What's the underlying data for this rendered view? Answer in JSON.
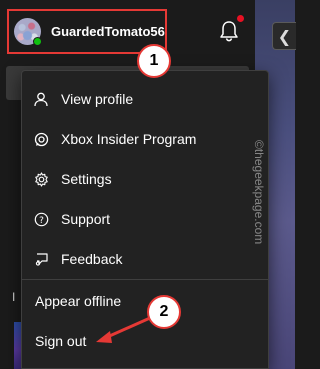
{
  "header": {
    "gamertag": "GuardedTomato56",
    "presence": "online"
  },
  "menu": {
    "items": [
      {
        "label": "View profile",
        "icon": "person-icon"
      },
      {
        "label": "Xbox Insider Program",
        "icon": "xbox-insider-icon"
      },
      {
        "label": "Settings",
        "icon": "gear-icon"
      },
      {
        "label": "Support",
        "icon": "help-icon"
      },
      {
        "label": "Feedback",
        "icon": "feedback-icon"
      }
    ],
    "appear_offline": "Appear offline",
    "sign_out": "Sign out"
  },
  "annotations": {
    "step1": "1",
    "step2": "2",
    "color": "#e53935"
  },
  "watermark": "©thegeekpage.com",
  "background": {
    "left_letter": "I"
  }
}
